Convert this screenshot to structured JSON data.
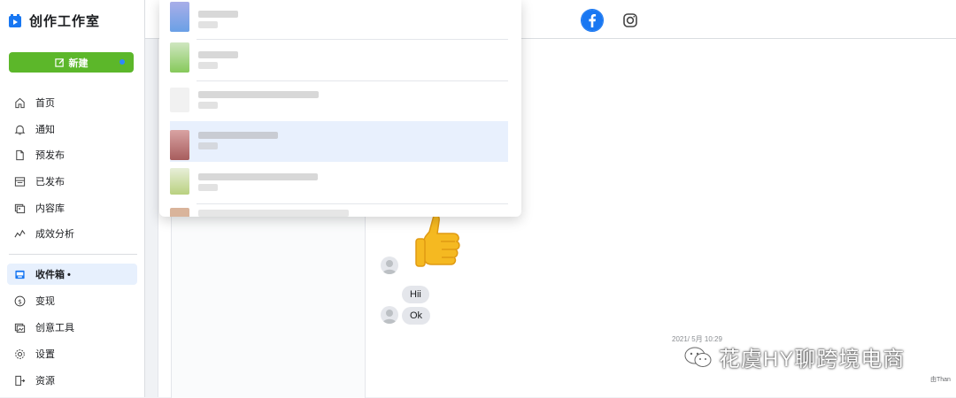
{
  "app": {
    "title": "创作工作室"
  },
  "new_button": {
    "label": "新建"
  },
  "nav": {
    "items": [
      {
        "label": "首页",
        "icon": "home-icon"
      },
      {
        "label": "通知",
        "icon": "bell-icon"
      },
      {
        "label": "预发布",
        "icon": "document-icon"
      },
      {
        "label": "已发布",
        "icon": "calendar-icon"
      },
      {
        "label": "内容库",
        "icon": "media-library-icon"
      },
      {
        "label": "成效分析",
        "icon": "analytics-icon"
      }
    ],
    "items2": [
      {
        "label": "收件箱 •",
        "icon": "inbox-icon",
        "active": true
      },
      {
        "label": "变现",
        "icon": "dollar-icon"
      },
      {
        "label": "创意工具",
        "icon": "creative-tools-icon"
      },
      {
        "label": "设置",
        "icon": "gear-icon"
      },
      {
        "label": "资源",
        "icon": "resources-icon"
      }
    ]
  },
  "topbar": {
    "platforms": [
      "facebook-icon",
      "instagram-icon"
    ]
  },
  "colors": {
    "accent_green": "#5cb72a",
    "facebook_blue": "#1877f2",
    "active_bg": "#e7f0fd"
  },
  "chat": {
    "messages": [
      "Hii",
      "Ok"
    ],
    "timestamp": "2021/ 5月 10:29",
    "footer_note": "由Than"
  },
  "watermark": {
    "text": "花虞HY聊跨境电商"
  }
}
